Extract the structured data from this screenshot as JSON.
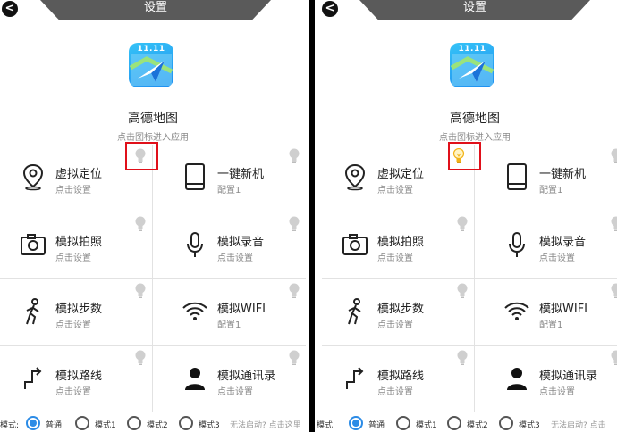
{
  "header": {
    "title": "设置",
    "back_icon": "<"
  },
  "app": {
    "icon_label": "11.11",
    "name": "高德地图",
    "hint": "点击图标进入应用"
  },
  "features": [
    {
      "title": "虚拟定位",
      "sub": "点击设置",
      "icon": "location-pin-icon"
    },
    {
      "title": "一键新机",
      "sub": "配置1",
      "icon": "phone-device-icon"
    },
    {
      "title": "模拟拍照",
      "sub": "点击设置",
      "icon": "camera-icon"
    },
    {
      "title": "模拟录音",
      "sub": "点击设置",
      "icon": "microphone-icon"
    },
    {
      "title": "模拟步数",
      "sub": "点击设置",
      "icon": "walking-icon"
    },
    {
      "title": "模拟WIFI",
      "sub": "配置1",
      "icon": "wifi-icon"
    },
    {
      "title": "模拟路线",
      "sub": "点击设置",
      "icon": "route-arrow-icon"
    },
    {
      "title": "模拟通讯录",
      "sub": "点击设置",
      "icon": "contact-person-icon"
    }
  ],
  "bottom": {
    "left_mode_label": "模式:",
    "right_mode_label": "模式:",
    "options": [
      "普通",
      "模式1",
      "模式2",
      "模式3"
    ],
    "hint_left": "无法启动? 点击这里",
    "hint_right": "无法启动? 点击"
  },
  "colors": {
    "accent": "#2b8be6",
    "highlight": "#e0101a",
    "bulb_on": "#f2b215",
    "bulb_off": "#cfcfcf"
  }
}
